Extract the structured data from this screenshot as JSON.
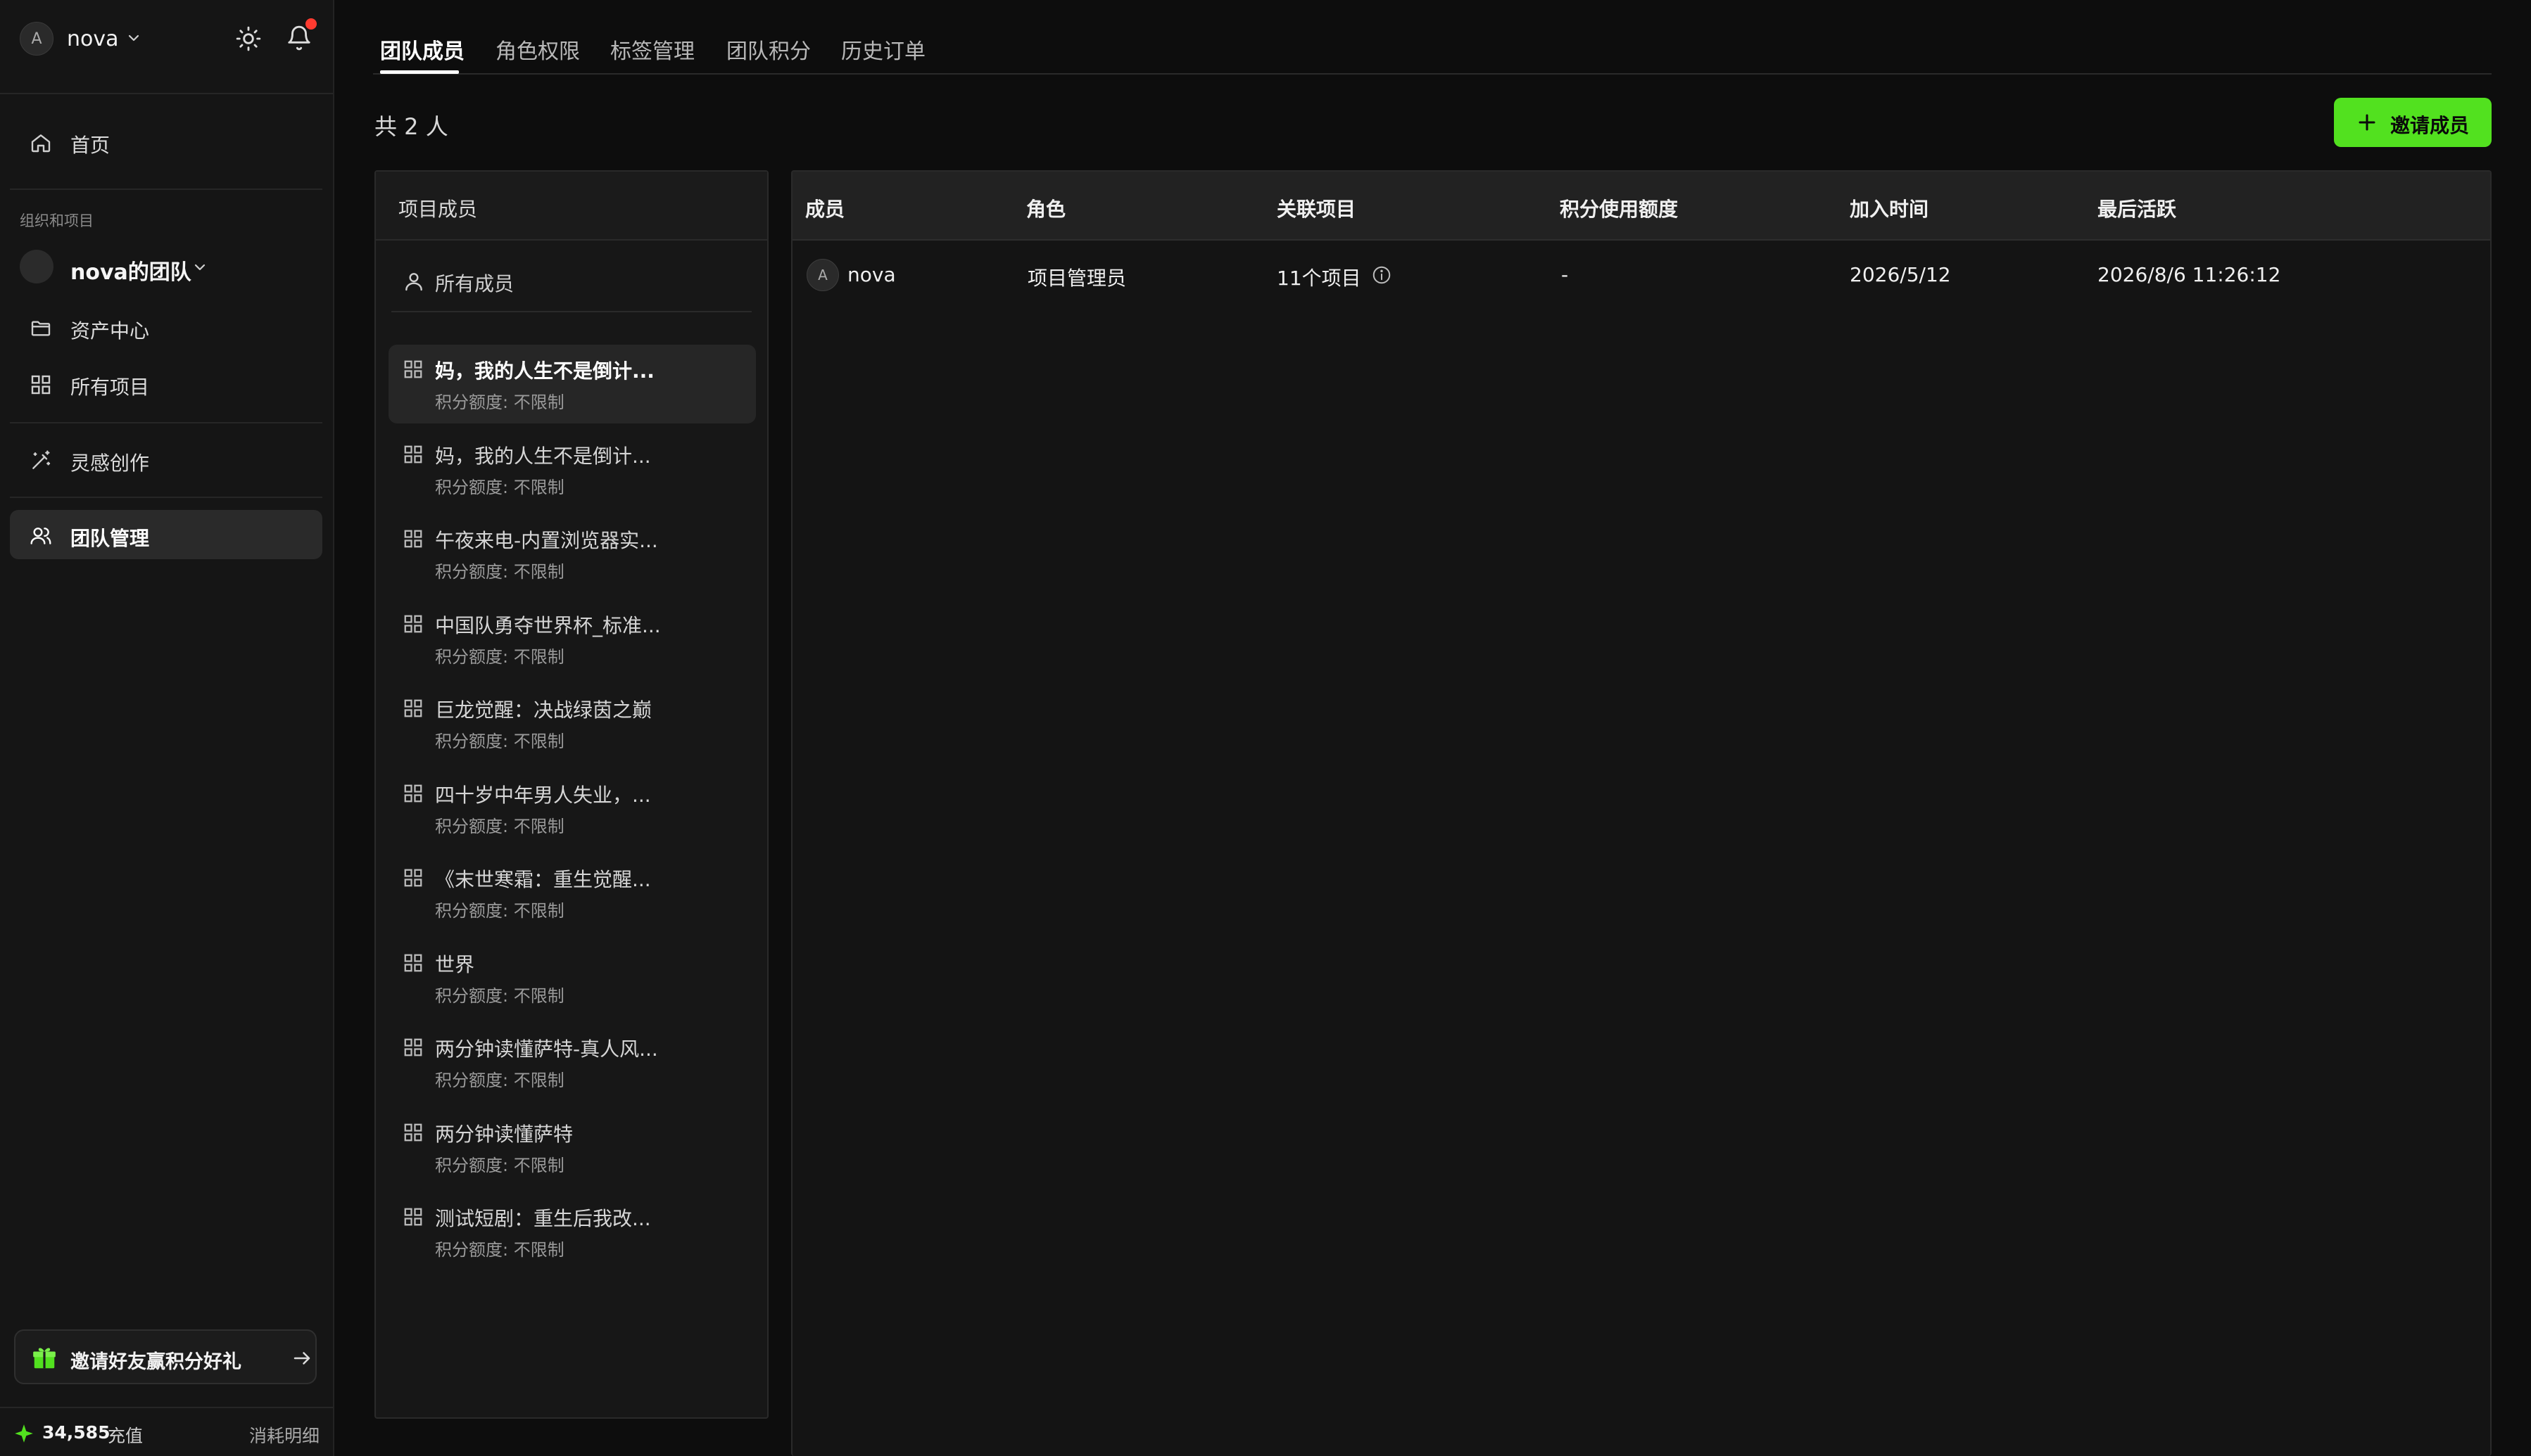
{
  "user": {
    "avatar_letter": "A",
    "name": "nova"
  },
  "sidebar": {
    "home_label": "首页",
    "section_label": "组织和项目",
    "team_name": "nova的团队",
    "assets_label": "资产中心",
    "all_projects_label": "所有项目",
    "inspiration_label": "灵感创作",
    "team_manage_label": "团队管理",
    "invite_card_text": "邀请好友赢积分好礼",
    "credits": "34,585",
    "recharge_label": "充值",
    "consume_label": "消耗明细"
  },
  "tabs": [
    "团队成员",
    "角色权限",
    "标签管理",
    "团队积分",
    "历史订单"
  ],
  "main": {
    "total_text": "共 2 人",
    "invite_button_label": "邀请成员"
  },
  "project_panel": {
    "header": "项目成员",
    "all_members_label": "所有成员",
    "items": [
      {
        "name": "妈，我的人生不是倒计...",
        "quota": "积分额度: 不限制"
      },
      {
        "name": "妈，我的人生不是倒计...",
        "quota": "积分额度: 不限制"
      },
      {
        "name": "午夜来电-内置浏览器实...",
        "quota": "积分额度: 不限制"
      },
      {
        "name": "中国队勇夺世界杯_标准...",
        "quota": "积分额度: 不限制"
      },
      {
        "name": "巨龙觉醒：决战绿茵之巅",
        "quota": "积分额度: 不限制"
      },
      {
        "name": "四十岁中年男人失业，...",
        "quota": "积分额度: 不限制"
      },
      {
        "name": "《末世寒霜：重生觉醒...",
        "quota": "积分额度: 不限制"
      },
      {
        "name": "世界",
        "quota": "积分额度: 不限制"
      },
      {
        "name": "两分钟读懂萨特-真人风...",
        "quota": "积分额度: 不限制"
      },
      {
        "name": "两分钟读懂萨特",
        "quota": "积分额度: 不限制"
      },
      {
        "name": "测试短剧：重生后我改...",
        "quota": "积分额度: 不限制"
      }
    ]
  },
  "table": {
    "columns": [
      "成员",
      "角色",
      "关联项目",
      "积分使用额度",
      "加入时间",
      "最后活跃"
    ],
    "rows": [
      {
        "avatar_letter": "A",
        "member": "nova",
        "role": "项目管理员",
        "projects": "11个项目",
        "quota": "-",
        "joined": "2026/5/12",
        "last_active": "2026/8/6 11:26:12"
      }
    ]
  },
  "colors": {
    "accent": "#52e11f",
    "notification": "#ff3b30",
    "background": "#0d0d0d",
    "sidebar": "#151515"
  }
}
